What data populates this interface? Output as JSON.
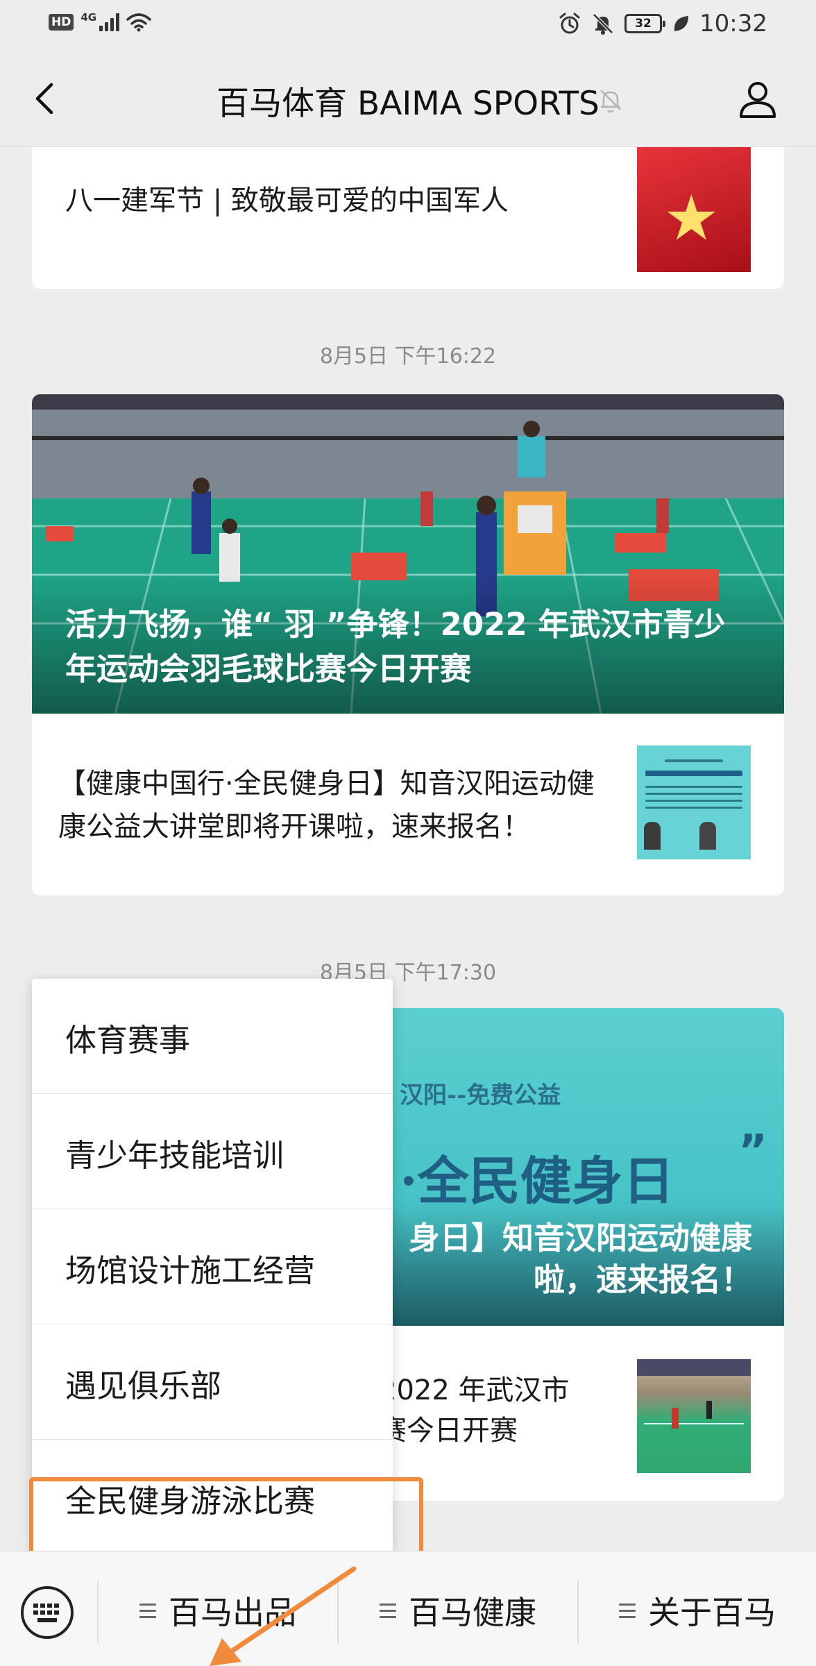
{
  "status_bar": {
    "hd": "HD",
    "network": "4G",
    "battery": "32",
    "time": "10:32"
  },
  "nav": {
    "title": "百马体育 BAIMA SPORTS",
    "back_icon": "chevron-left-icon",
    "mute_icon": "bell-off-icon",
    "profile_icon": "person-icon"
  },
  "feed": {
    "card_top": {
      "title": "八一建军节 | 致敬最可爱的中国军人",
      "thumb_icon": "star-icon"
    },
    "timestamp_1": "8月5日  下午16:22",
    "card_main": {
      "hero_title": "活力飞扬，谁“ 羽 ”争锋！2022 年武汉市青少年运动会羽毛球比赛今日开赛",
      "sub_title": "【健康中国行·全民健身日】知音汉阳运动健康公益大讲堂即将开课啦，速来报名！"
    },
    "timestamp_2": "8月5日  下午17:30",
    "card_second": {
      "hero_free_text": "汉阳--免费公益",
      "hero_big_text": "·全民健身日",
      "hero_quote": "”",
      "hero_title": "身日】知音汉阳运动健康\n啦，速来报名！",
      "sub_title": "2022 年武汉市\n赛今日开赛"
    }
  },
  "popup_menu": {
    "items": [
      {
        "label": "体育赛事"
      },
      {
        "label": "青少年技能培训"
      },
      {
        "label": "场馆设计施工经营"
      },
      {
        "label": "遇见俱乐部"
      },
      {
        "label": "全民健身游泳比赛"
      }
    ]
  },
  "bottom_bar": {
    "keyboard_icon": "keyboard-icon",
    "tabs": [
      {
        "label": "百马出品"
      },
      {
        "label": "百马健康"
      },
      {
        "label": "关于百马"
      }
    ]
  },
  "colors": {
    "highlight": "#f08a3c",
    "background": "#ededed"
  }
}
